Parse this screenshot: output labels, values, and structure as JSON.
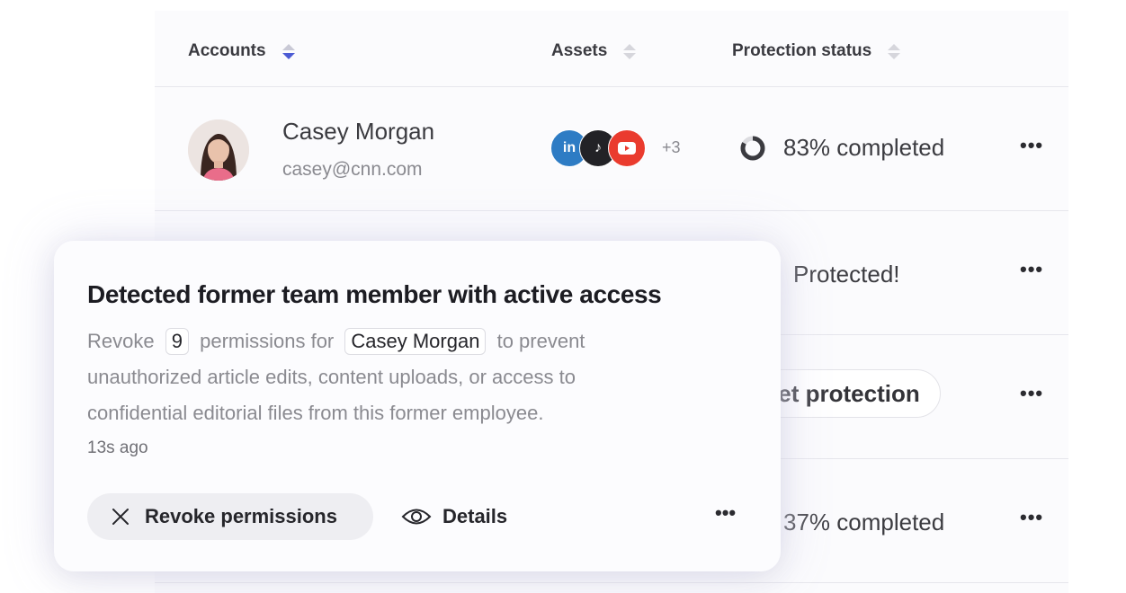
{
  "table": {
    "headers": {
      "accounts": "Accounts",
      "assets": "Assets",
      "protection": "Protection status"
    },
    "rows": [
      {
        "name": "Casey Morgan",
        "email": "casey@cnn.com",
        "assets_extra": "+3",
        "status": "83% completed",
        "progress": 0.83,
        "more": "•••"
      },
      {
        "status": "Protected!",
        "more": "•••"
      },
      {
        "action_label": "et protection",
        "more": "•••"
      },
      {
        "status": "37% completed",
        "progress": 0.37,
        "more": "•••"
      }
    ]
  },
  "notification": {
    "title": "Detected former team member with active access",
    "body_1": "Revoke",
    "count": "9",
    "body_2": "permissions for",
    "person": "Casey Morgan",
    "body_3": "to prevent unauthorized article edits, content uploads, or access to confidential editorial files from this former employee.",
    "time": "13s ago",
    "revoke_label": "Revoke permissions",
    "details_label": "Details",
    "more": "•••"
  },
  "colors": {
    "sort_active": "#4c5bd4",
    "linkedin": "#2e7cc4",
    "tiktok": "#222226",
    "youtube": "#ea3b2e"
  }
}
